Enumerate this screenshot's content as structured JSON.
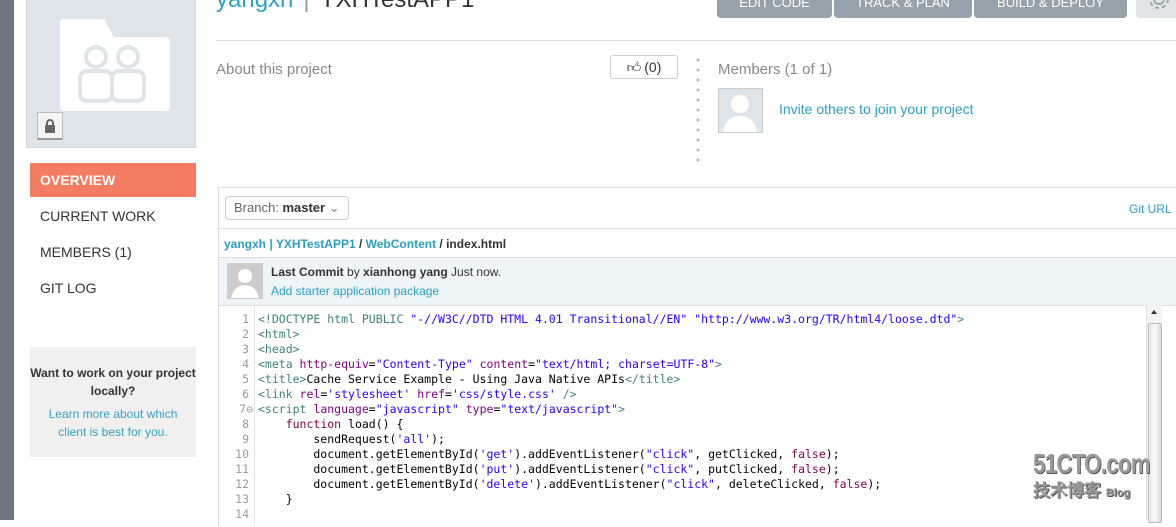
{
  "header": {
    "user": "yangxh",
    "separator": "|",
    "project": "YXHTestAPP1",
    "buttons": [
      "EDIT CODE",
      "TRACK & PLAN",
      "BUILD & DEPLOY"
    ],
    "settings_icon": "gear-icon"
  },
  "nav": {
    "items": [
      {
        "label": "OVERVIEW",
        "active": true
      },
      {
        "label": "CURRENT WORK"
      },
      {
        "label": "MEMBERS (1)"
      },
      {
        "label": "GIT LOG"
      }
    ]
  },
  "promo": {
    "question": "Want to work on your project locally?",
    "link": "Learn more about which client is best for you."
  },
  "about": {
    "label": "About this project",
    "like_count": "(0)"
  },
  "members": {
    "title": "Members (1 of 1)",
    "invite": "Invite others to join your project"
  },
  "repo": {
    "branch_label": "Branch:",
    "branch": "master",
    "git_url": "Git URL",
    "breadcrumb": {
      "owner_project": "yangxh | YXHTestAPP1",
      "sep1": " / ",
      "folder": "WebContent",
      "sep2": " / ",
      "file": "index.html"
    },
    "commit": {
      "label": "Last Commit",
      "by": " by ",
      "author": "xianhong yang",
      "when": " Just now.",
      "message": "Add starter application package"
    }
  },
  "code": {
    "lines": [
      [
        [
          "tg",
          "<!DOCTYPE html PUBLIC "
        ],
        [
          "vl",
          "\"-//W3C//DTD HTML 4.01 Transitional//EN\" \"http://www.w3.org/TR/html4/loose.dtd\""
        ],
        [
          "tg",
          ">"
        ]
      ],
      [
        [
          "tg",
          "<html>"
        ]
      ],
      [
        [
          "tg",
          "<head>"
        ]
      ],
      [
        [
          "tg",
          "<meta "
        ],
        [
          "at",
          "http-equiv"
        ],
        [
          "tx",
          "="
        ],
        [
          "vl",
          "\"Content-Type\""
        ],
        [
          "tx",
          " "
        ],
        [
          "at",
          "content"
        ],
        [
          "tx",
          "="
        ],
        [
          "vl",
          "\"text/html; charset=UTF-8\""
        ],
        [
          "tg",
          ">"
        ]
      ],
      [
        [
          "tg",
          "<title>"
        ],
        [
          "tx",
          "Cache Service Example - Using Java Native APIs"
        ],
        [
          "tg",
          "</title>"
        ]
      ],
      [
        [
          "tg",
          "<link "
        ],
        [
          "at",
          "rel"
        ],
        [
          "tx",
          "="
        ],
        [
          "vl",
          "'stylesheet'"
        ],
        [
          "tx",
          " "
        ],
        [
          "at",
          "href"
        ],
        [
          "tx",
          "="
        ],
        [
          "vl",
          "'css/style.css'"
        ],
        [
          "tg",
          " />"
        ]
      ],
      [
        [
          "tg",
          "<script "
        ],
        [
          "at",
          "language"
        ],
        [
          "tx",
          "="
        ],
        [
          "vl",
          "\"javascript\""
        ],
        [
          "tx",
          " "
        ],
        [
          "at",
          "type"
        ],
        [
          "tx",
          "="
        ],
        [
          "vl",
          "\"text/javascript\""
        ],
        [
          "tg",
          ">"
        ]
      ],
      [
        [
          "tx",
          "    "
        ],
        [
          "kw",
          "function"
        ],
        [
          "tx",
          " load() {"
        ]
      ],
      [
        [
          "tx",
          "        sendRequest("
        ],
        [
          "vl",
          "'all'"
        ],
        [
          "tx",
          ");"
        ]
      ],
      [
        [
          "tx",
          "        document.getElementById("
        ],
        [
          "vl",
          "'get'"
        ],
        [
          "tx",
          ").addEventListener("
        ],
        [
          "vl",
          "\"click\""
        ],
        [
          "tx",
          ", getClicked, "
        ],
        [
          "kw",
          "false"
        ],
        [
          "tx",
          ");"
        ]
      ],
      [
        [
          "tx",
          "        document.getElementById("
        ],
        [
          "vl",
          "'put'"
        ],
        [
          "tx",
          ").addEventListener("
        ],
        [
          "vl",
          "\"click\""
        ],
        [
          "tx",
          ", putClicked, "
        ],
        [
          "kw",
          "false"
        ],
        [
          "tx",
          ");"
        ]
      ],
      [
        [
          "tx",
          "        document.getElementById("
        ],
        [
          "vl",
          "'delete'"
        ],
        [
          "tx",
          ").addEventListener("
        ],
        [
          "vl",
          "\"click\""
        ],
        [
          "tx",
          ", deleteClicked, "
        ],
        [
          "kw",
          "false"
        ],
        [
          "tx",
          ");"
        ]
      ],
      [
        [
          "tx",
          "    }"
        ]
      ],
      []
    ]
  },
  "watermark": {
    "logo": "51CTO.com",
    "sub": "技术博客",
    "blog": "Blog"
  },
  "colors": {
    "accent": "#f47c62",
    "link": "#2b9fc4",
    "button": "#96a2ab"
  }
}
